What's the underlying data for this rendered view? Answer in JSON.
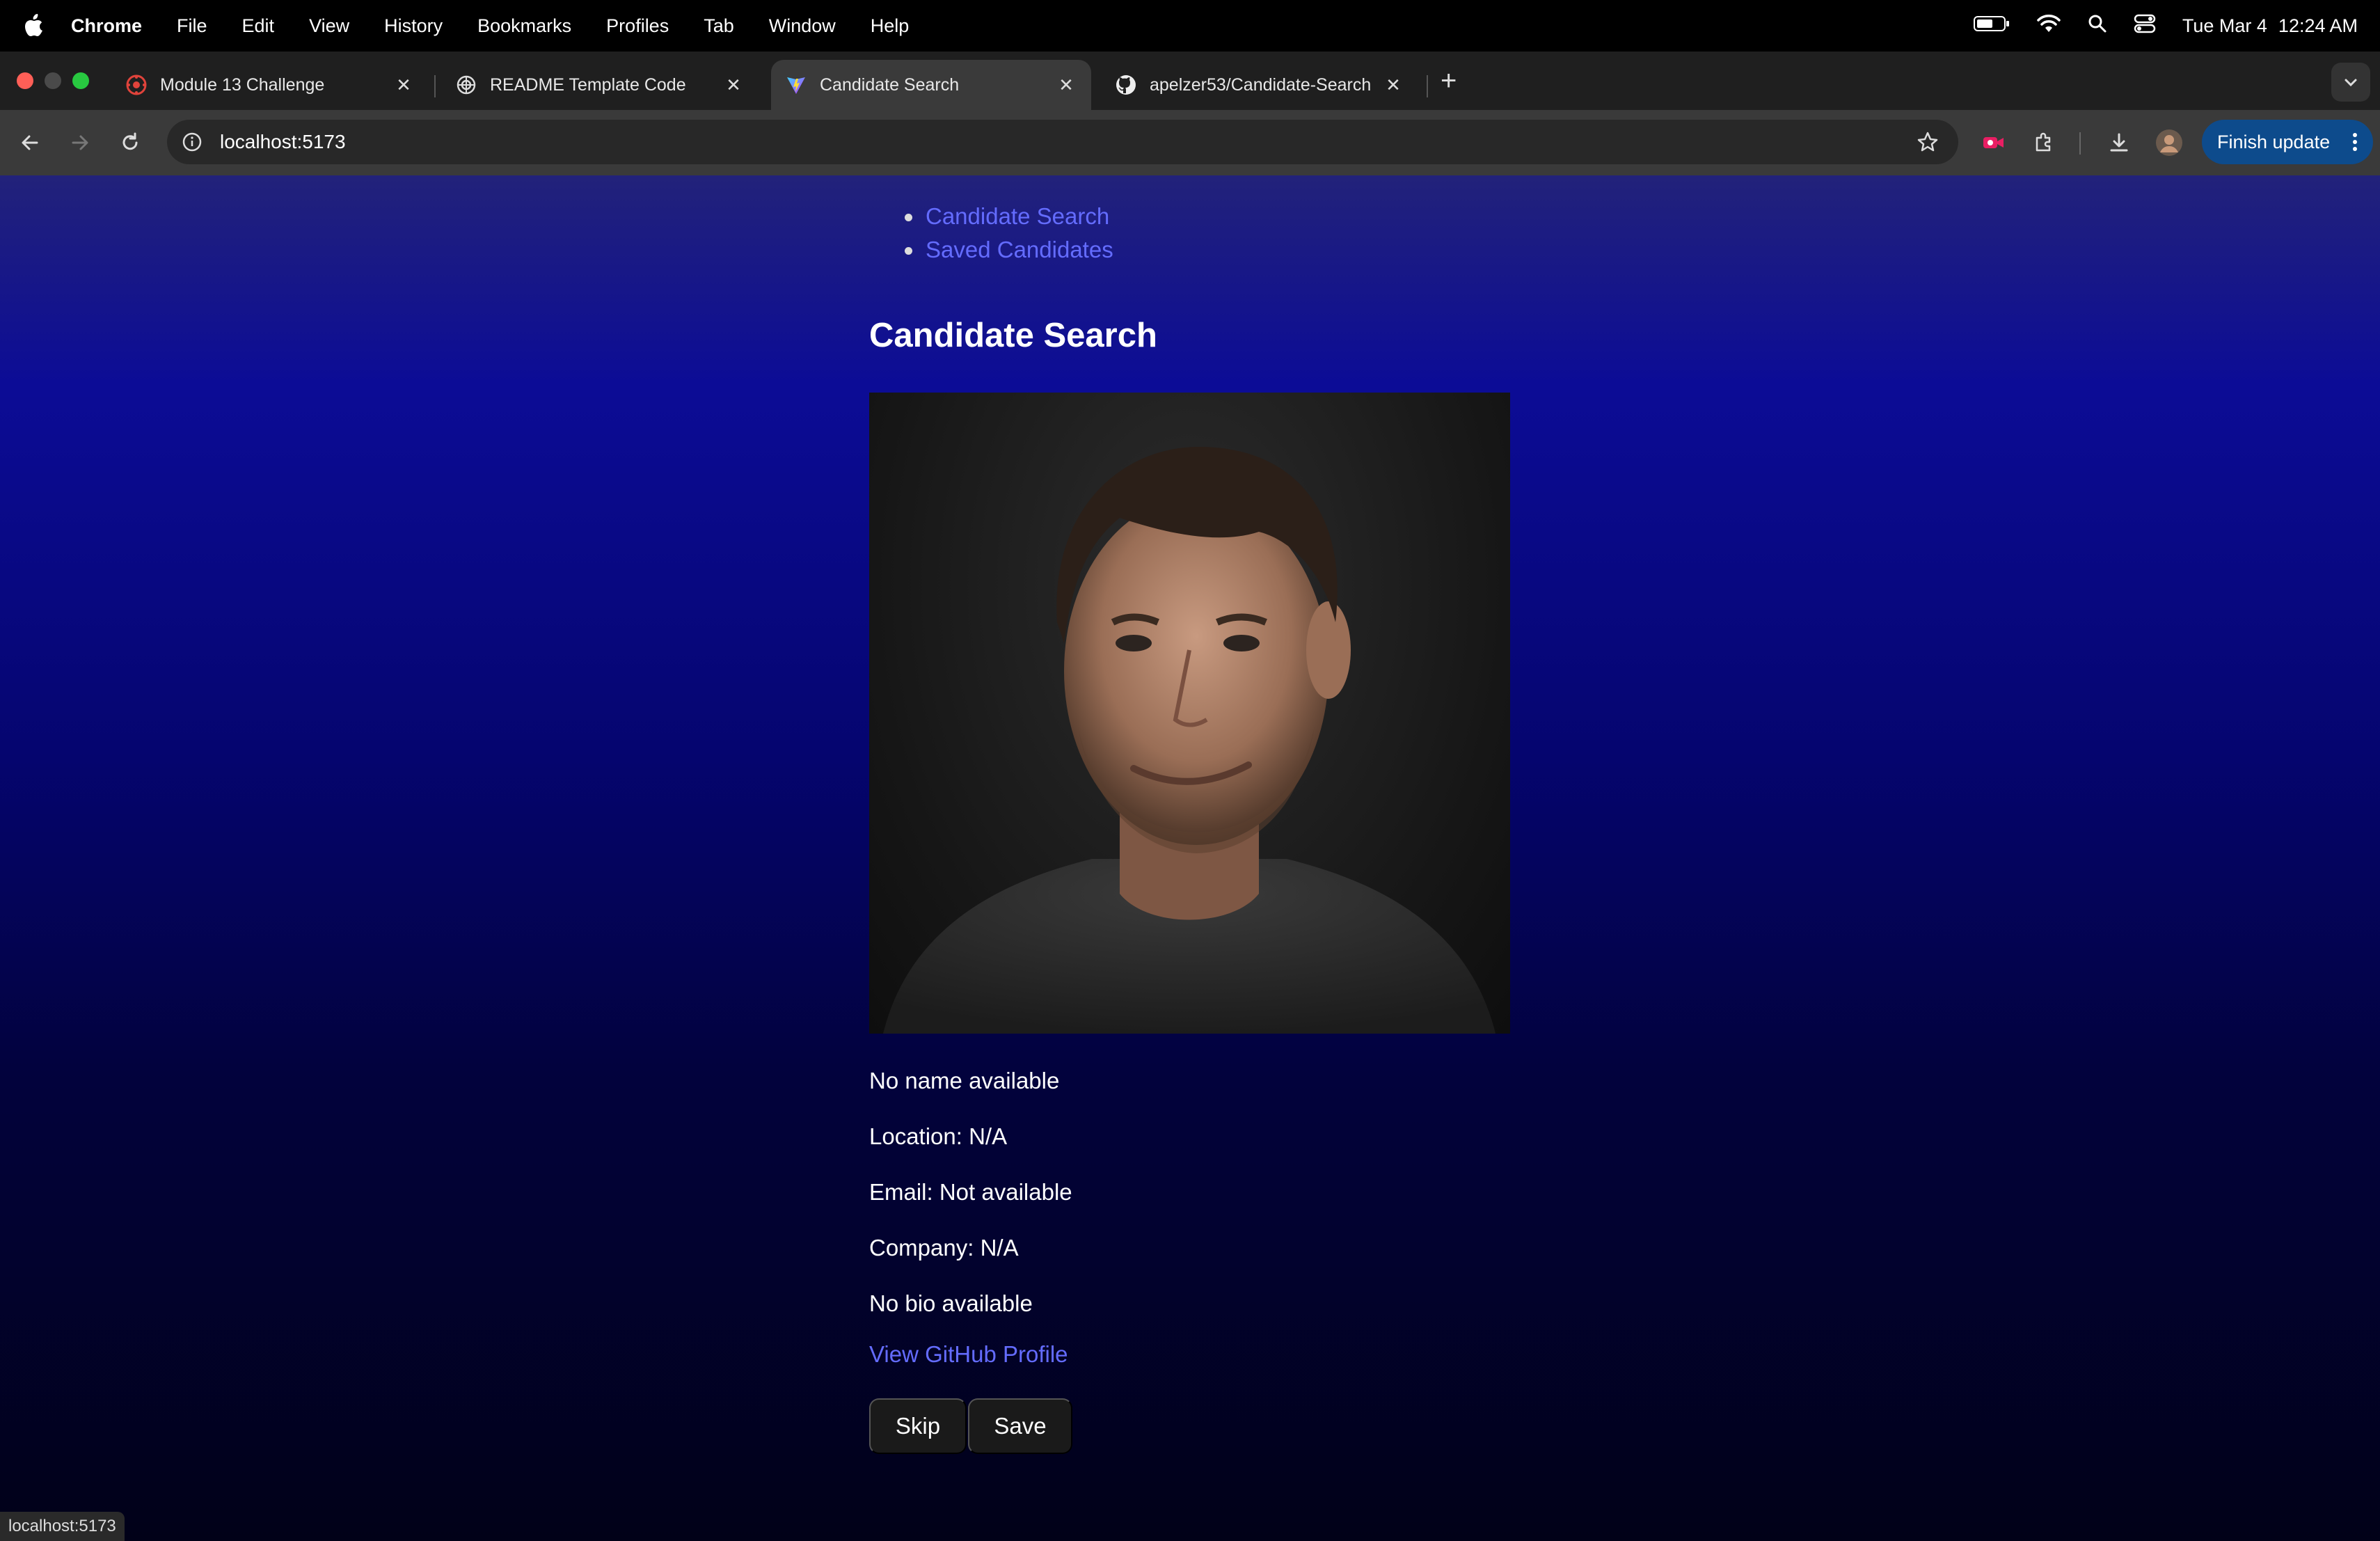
{
  "menubar": {
    "app_name": "Chrome",
    "items": [
      "File",
      "Edit",
      "View",
      "History",
      "Bookmarks",
      "Profiles",
      "Tab",
      "Window",
      "Help"
    ],
    "date": "Tue Mar 4",
    "time": "12:24 AM"
  },
  "tabs": [
    {
      "title": "Module 13 Challenge",
      "icon": "canvas-icon"
    },
    {
      "title": "README Template Code",
      "icon": "openai-icon"
    },
    {
      "title": "Candidate Search",
      "icon": "vite-icon",
      "active": true
    },
    {
      "title": "apelzer53/Candidate-Search",
      "icon": "github-icon"
    }
  ],
  "toolbar": {
    "url": "localhost:5173",
    "finish_update_label": "Finish update"
  },
  "page": {
    "nav": [
      "Candidate Search",
      "Saved Candidates"
    ],
    "heading": "Candidate Search",
    "candidate": {
      "name": "No name available",
      "location": "Location: N/A",
      "email": "Email: Not available",
      "company": "Company: N/A",
      "bio": "No bio available",
      "profile_link": "View GitHub Profile"
    },
    "buttons": {
      "skip": "Skip",
      "save": "Save"
    }
  },
  "status_bar": {
    "text": "localhost:5173"
  },
  "colors": {
    "link": "#646cff",
    "accent": "#0d4b8c"
  }
}
